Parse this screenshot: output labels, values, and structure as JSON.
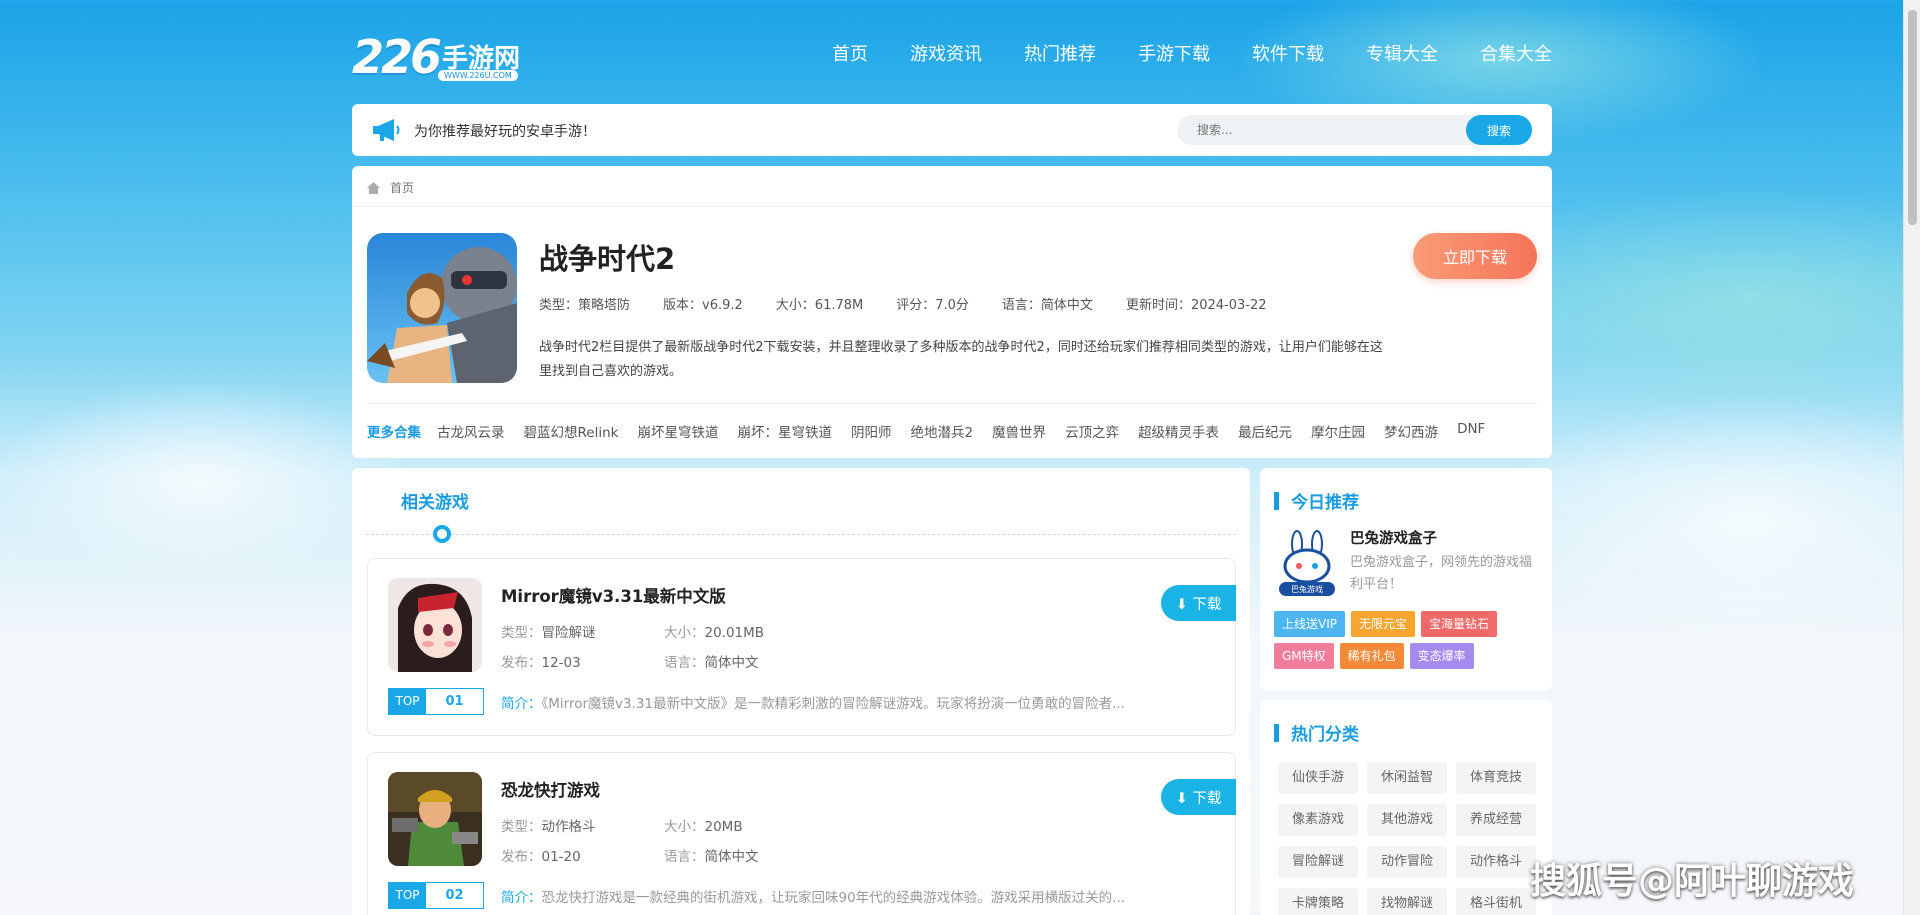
{
  "header": {
    "logo_number": "226",
    "logo_text": "手游网",
    "logo_url": "WWW.226U.COM",
    "nav": [
      "首页",
      "游戏资讯",
      "热门推荐",
      "手游下载",
      "软件下载",
      "专辑大全",
      "合集大全"
    ]
  },
  "notice": {
    "text": "为你推荐最好玩的安卓手游！",
    "search_placeholder": "搜索...",
    "search_button": "搜索"
  },
  "breadcrumb": {
    "home": "首页"
  },
  "game": {
    "title": "战争时代2",
    "type": "类型：策略塔防",
    "version": "版本：v6.9.2",
    "size": "大小：61.78M",
    "rating": "评分：7.0分",
    "language": "语言：简体中文",
    "updated": "更新时间：2024-03-22",
    "description": "战争时代2栏目提供了最新版战争时代2下载安装，并且整理收录了多种版本的战争时代2，同时还给玩家们推荐相同类型的游戏，让用户们能够在这里找到自己喜欢的游戏。",
    "download_label": "立即下载"
  },
  "more": {
    "label": "更多合集",
    "tags": [
      "古龙风云录",
      "碧蓝幻想Relink",
      "崩坏星穹铁道",
      "崩坏：星穹铁道",
      "阴阳师",
      "绝地潜兵2",
      "魔兽世界",
      "云顶之弈",
      "超级精灵手表",
      "最后纪元",
      "摩尔庄园",
      "梦幻西游",
      "DNF"
    ]
  },
  "related": {
    "title": "相关游戏",
    "items": [
      {
        "name": "Mirror魔镜v3.31最新中文版",
        "type_label": "类型：",
        "type": "冒险解谜",
        "size_label": "大小：",
        "size": "20.01MB",
        "date_label": "发布：",
        "date": "12-03",
        "lang_label": "语言：",
        "lang": "简体中文",
        "rank_top": "TOP",
        "rank": "01",
        "intro_label": "简介：",
        "intro": "《Mirror魔镜v3.31最新中文版》是一款精彩刺激的冒险解谜游戏。玩家将扮演一位勇敢的冒险者...",
        "download": "下载"
      },
      {
        "name": "恐龙快打游戏",
        "type_label": "类型：",
        "type": "动作格斗",
        "size_label": "大小：",
        "size": "20MB",
        "date_label": "发布：",
        "date": "01-20",
        "lang_label": "语言：",
        "lang": "简体中文",
        "rank_top": "TOP",
        "rank": "02",
        "intro_label": "简介：",
        "intro": "恐龙快打游戏是一款经典的街机游戏，让玩家回味90年代的经典游戏体验。游戏采用横版过关的...",
        "download": "下载"
      }
    ]
  },
  "today": {
    "title": "今日推荐",
    "logo_text": "巴兔游戏",
    "name": "巴兔游戏盒子",
    "desc": "巴兔游戏盒子，网领先的游戏福利平台！",
    "tags": [
      {
        "text": "上线送VIP",
        "color": "#4db6f0"
      },
      {
        "text": "无限元宝",
        "color": "#f7a531"
      },
      {
        "text": "宝海量钻石",
        "color": "#f2696a"
      },
      {
        "text": "GM特权",
        "color": "#f27c9c"
      },
      {
        "text": "稀有礼包",
        "color": "#f28a3a"
      },
      {
        "text": "变态爆率",
        "color": "#a58af0"
      }
    ]
  },
  "hot": {
    "title": "热门分类",
    "categories": [
      "仙侠手游",
      "休闲益智",
      "体育竞技",
      "像素游戏",
      "其他游戏",
      "养成经营",
      "冒险解谜",
      "动作冒险",
      "动作格斗",
      "卡牌策略",
      "找物解谜",
      "格斗街机"
    ]
  },
  "watermark": "搜狐号@阿叶聊游戏",
  "colors": {
    "accent": "#1aa7e8",
    "download": "#f5745a"
  }
}
